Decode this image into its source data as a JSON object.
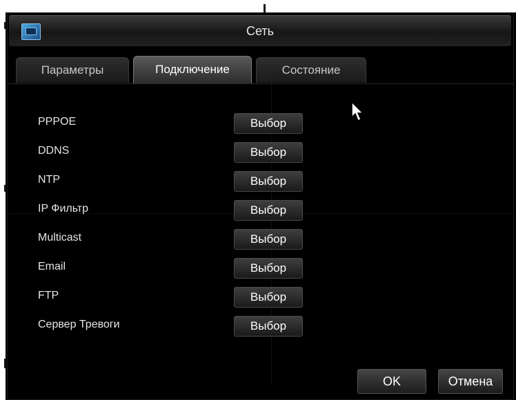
{
  "window": {
    "title": "Сеть"
  },
  "tabs": [
    {
      "label": "Параметры"
    },
    {
      "label": "Подключение"
    },
    {
      "label": "Состояние"
    }
  ],
  "rows": [
    {
      "label": "PPPOE",
      "button": "Выбор"
    },
    {
      "label": "DDNS",
      "button": "Выбор"
    },
    {
      "label": "NTP",
      "button": "Выбор"
    },
    {
      "label": "IP Фильтр",
      "button": "Выбор"
    },
    {
      "label": "Multicast",
      "button": "Выбор"
    },
    {
      "label": "Email",
      "button": "Выбор"
    },
    {
      "label": "FTP",
      "button": "Выбор"
    },
    {
      "label": "Сервер Тревоги",
      "button": "Выбор"
    }
  ],
  "footer": {
    "ok_label": "OK",
    "cancel_label": "Отмена"
  },
  "icons": {
    "title": "network-icon",
    "pointer": "mouse-cursor-icon"
  },
  "colors": {
    "background": "#000000",
    "text": "#e6e6e6",
    "active_tab": "#595959"
  }
}
